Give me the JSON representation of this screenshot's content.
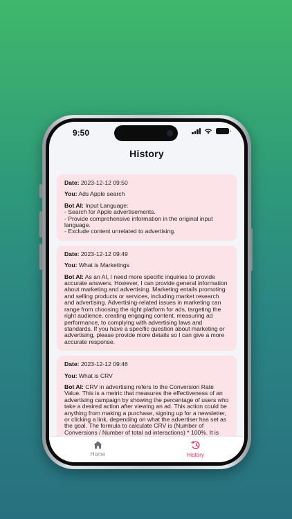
{
  "status_bar": {
    "time": "9:50"
  },
  "nav": {
    "title": "History"
  },
  "labels": {
    "date": "Date:",
    "you": "You:",
    "bot": "Bot AI:"
  },
  "history": [
    {
      "date": "2023-12-12 09:50",
      "you": "Ads Apple search",
      "bot": "Input Language:\n- Search for Apple advertisements.\n- Provide comprehensive information in the original input language.\n- Exclude content unrelated to advertising."
    },
    {
      "date": "2023-12-12 09:49",
      "you": "What is Marketings",
      "bot": "As an AI, I need more specific inquiries to provide accurate answers. However, I can provide general information about marketing and advertising. Marketing entails promoting and selling products or services, including market research and advertising. Advertising-related issues in marketing can range from choosing the right platform for ads, targeting the right audience, creating engaging content, measuring ad performance, to complying with advertising laws and standards. If you have a specific question about marketing or advertising, please provide more details so I can give a more accurate response."
    },
    {
      "date": "2023-12-12 09:46",
      "you": "What is CRV",
      "bot": "CRV in advertising refers to the Conversion Rate Value. This is a metric that measures the effectiveness of an advertising campaign by showing the percentage of users who take a desired action after viewing an ad. This action could be anything from making a purchase, signing up for a newsletter, or clicking a link, depending on what the advertiser has set as the goal. The formula to calculate CRV is (Number of Conversions / Number of total ad interactions) * 100%. It is important in helping businesses understand how well their ads are working."
    }
  ],
  "tabs": [
    {
      "label": "Home",
      "icon": "home-icon",
      "active": false
    },
    {
      "label": "History",
      "icon": "history-icon",
      "active": true
    }
  ],
  "colors": {
    "accent": "#e0305a",
    "card": "#fbe3e7",
    "inactive": "#8a8a8f"
  }
}
